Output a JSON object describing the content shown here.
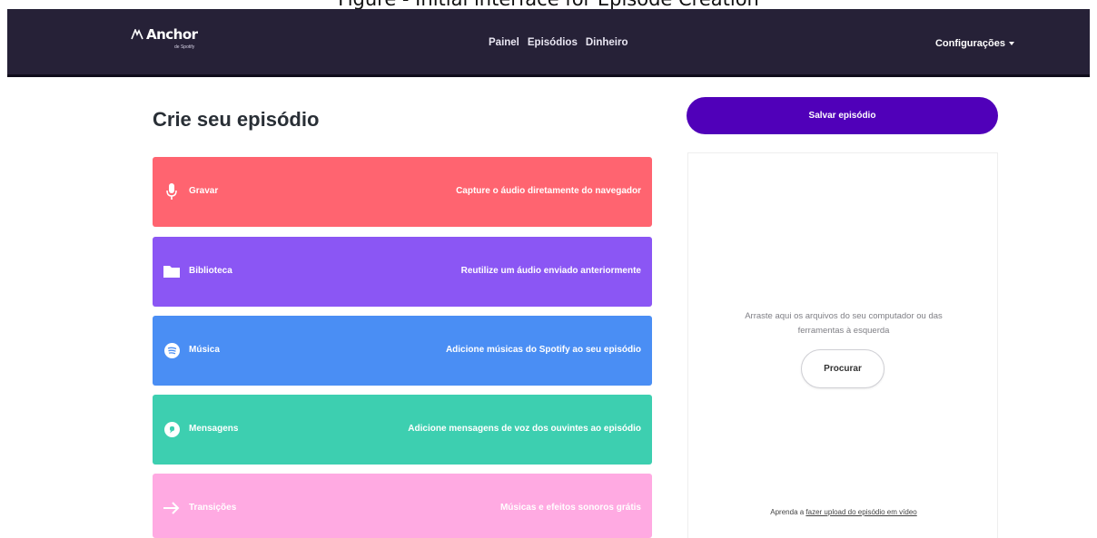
{
  "caption": "Figure - Initial interface for Episode Creation",
  "brand": {
    "name": "Anchor",
    "sub": "de Spotify"
  },
  "nav": {
    "links": [
      "Painel",
      "Episódios",
      "Dinheiro"
    ],
    "settings": "Configurações"
  },
  "page": {
    "title": "Crie seu episódio",
    "save_button": "Salvar episódio"
  },
  "tiles": [
    {
      "name": "Gravar",
      "desc": "Capture o áudio diretamente do navegador",
      "color": "#ff6470",
      "icon": "microphone-icon"
    },
    {
      "name": "Biblioteca",
      "desc": "Reutilize um áudio enviado anteriormente",
      "color": "#8b56f4",
      "icon": "folder-icon"
    },
    {
      "name": "Música",
      "desc": "Adicione músicas do Spotify ao seu episódio",
      "color": "#4a8ef4",
      "icon": "spotify-icon"
    },
    {
      "name": "Mensagens",
      "desc": "Adicione mensagens de voz dos ouvintes ao episódio",
      "color": "#3dcfb0",
      "icon": "message-icon"
    },
    {
      "name": "Transições",
      "desc": "Músicas e efeitos sonoros grátis",
      "color": "#ffaae2",
      "icon": "arrow-right-icon"
    }
  ],
  "dropzone": {
    "text": "Arraste aqui os arquivos do seu computador ou das ferramentas à esquerda",
    "browse_button": "Procurar",
    "video_hint_prefix": "Aprenda a ",
    "video_hint_link": "fazer upload do episódio em vídeo"
  }
}
